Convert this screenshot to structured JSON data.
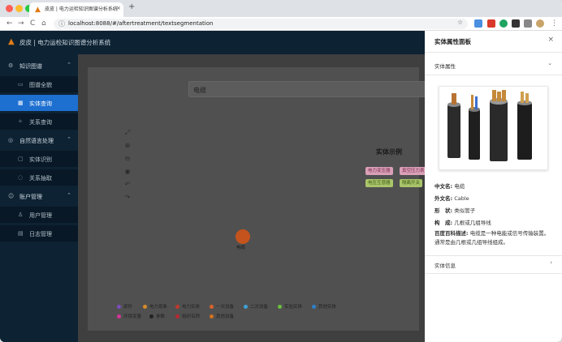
{
  "browser": {
    "tab_title": "皮皮 | 电力运检知识图谱分析系统",
    "tab_close": "×",
    "new_tab": "+",
    "url": "localhost:8088/#/aftertreatment/textsegmentation",
    "back": "←",
    "forward": "→",
    "reload": "C",
    "home": "⌂"
  },
  "app": {
    "title": "皮皮 | 电力运检知识图谱分析系统"
  },
  "sidebar": {
    "groups": [
      {
        "label": "知识图谱",
        "icon": "network-icon",
        "glyph": "⚙"
      },
      {
        "label": "自然语言处理",
        "icon": "nlp-icon",
        "glyph": "◎"
      },
      {
        "label": "账户管理",
        "icon": "account-icon",
        "glyph": "☺"
      }
    ],
    "items": [
      {
        "label": "图谱全貌",
        "glyph": "▭"
      },
      {
        "label": "实体查询",
        "glyph": "▦"
      },
      {
        "label": "关系查询",
        "glyph": "✧"
      },
      {
        "label": "实体识别",
        "glyph": "▢"
      },
      {
        "label": "关系抽取",
        "glyph": "◌"
      },
      {
        "label": "用户管理",
        "glyph": "♙"
      },
      {
        "label": "日志管理",
        "glyph": "▤"
      }
    ]
  },
  "main": {
    "search_value": "电缆",
    "legend_title": "实体示例",
    "examples": [
      "电力变压器",
      "真空压力表",
      "电压互感器",
      "隔离开关"
    ],
    "node_label": "电缆",
    "legend": [
      {
        "label": "部件",
        "color": "#7a4dbd"
      },
      {
        "label": "电力现象",
        "color": "#d88a2a"
      },
      {
        "label": "电力实体",
        "color": "#c0392b"
      },
      {
        "label": "一次设备",
        "color": "#d9622b"
      },
      {
        "label": "二次设备",
        "color": "#3fa0d8"
      },
      {
        "label": "实验实体",
        "color": "#6cbf3f"
      },
      {
        "label": "其他实体",
        "color": "#2d7fc9"
      },
      {
        "label": "环境变量",
        "color": "#d6339a"
      },
      {
        "label": "参数",
        "color": "#222222"
      },
      {
        "label": "组织名称",
        "color": "#b8282f"
      },
      {
        "label": "其他设备",
        "color": "#d4721f"
      }
    ]
  },
  "drawer": {
    "title": "实体属性面板",
    "close": "×",
    "attr_section": "实体属性",
    "fields": [
      {
        "label": "中文名:",
        "value": "电缆"
      },
      {
        "label": "外文名:",
        "value": "Cable"
      },
      {
        "label": "形　状:",
        "value": "类似管子"
      },
      {
        "label": "构　成:",
        "value": "几根或几组导线"
      }
    ],
    "baike_label": "百度百科描述:",
    "baike_text": "电缆是一种电能或信号传输装置。通常是由几根或几组导线组成。",
    "info_section": "实体信息"
  }
}
